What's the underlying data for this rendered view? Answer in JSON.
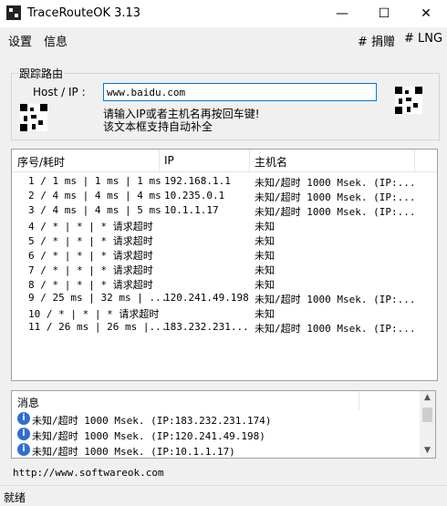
{
  "window": {
    "title": "TraceRouteOK 3.13",
    "minimize": "—",
    "maximize": "☐",
    "close": "✕"
  },
  "menu": {
    "settings": "设置",
    "info": "信息",
    "donate": "# 捐赠",
    "lng": "# LNG"
  },
  "group": {
    "label": "跟踪路由",
    "host_label": "Host / IP :",
    "host_value": "www.baidu.com",
    "hint_line1": "请输入IP或者主机名再按回车键!",
    "hint_line2": "该文本框支持自动补全"
  },
  "table": {
    "headers": {
      "seq": "序号/耗时",
      "ip": "IP",
      "host": "主机名"
    },
    "rows": [
      {
        "seq": "1 / 1 ms | 1 ms | 1 ms",
        "ip": "192.168.1.1",
        "host": "未知/超时 1000 Msek. (IP:..."
      },
      {
        "seq": "2 / 4 ms | 4 ms | 4 ms",
        "ip": "10.235.0.1",
        "host": "未知/超时 1000 Msek. (IP:..."
      },
      {
        "seq": "3 / 4 ms | 4 ms | 5 ms",
        "ip": "10.1.1.17",
        "host": "未知/超时 1000 Msek. (IP:..."
      },
      {
        "seq": "4 / * | * | * 请求超时",
        "ip": "",
        "host": "未知"
      },
      {
        "seq": "5 / * | * | * 请求超时",
        "ip": "",
        "host": "未知"
      },
      {
        "seq": "6 / * | * | * 请求超时",
        "ip": "",
        "host": "未知"
      },
      {
        "seq": "7 / * | * | * 请求超时",
        "ip": "",
        "host": "未知"
      },
      {
        "seq": "8 / * | * | * 请求超时",
        "ip": "",
        "host": "未知"
      },
      {
        "seq": "9 / 25 ms | 32 ms | ...",
        "ip": "120.241.49.198",
        "host": "未知/超时 1000 Msek. (IP:..."
      },
      {
        "seq": "10 / * | * | * 请求超时",
        "ip": "",
        "host": "未知"
      },
      {
        "seq": "11 / 26 ms | 26 ms |...",
        "ip": "183.232.231...",
        "host": "未知/超时 1000 Msek. (IP:..."
      }
    ]
  },
  "messages": {
    "header": "消息",
    "items": [
      "未知/超时 1000 Msek. (IP:183.232.231.174)",
      "未知/超时 1000 Msek. (IP:120.241.49.198)",
      "未知/超时 1000 Msek. (IP:10.1.1.17)"
    ]
  },
  "url": "http://www.softwareok.com",
  "status": "就绪",
  "icons": {
    "info": "info-icon",
    "app": "app-icon",
    "qr": "qr-code-icon"
  }
}
